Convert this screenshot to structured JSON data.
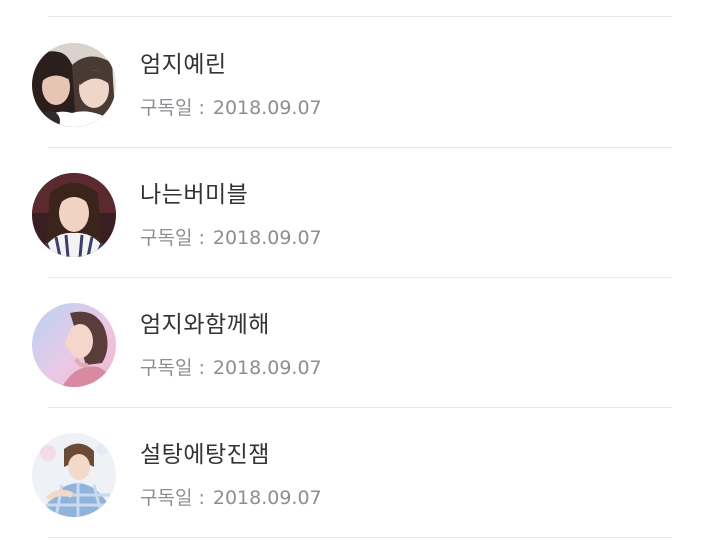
{
  "subscriptions": [
    {
      "name": "엄지예린",
      "date_label": "구독일",
      "separator": ":",
      "date": "2018.09.07"
    },
    {
      "name": "나는버미블",
      "date_label": "구독일",
      "separator": ":",
      "date": "2018.09.07"
    },
    {
      "name": "엄지와함께해",
      "date_label": "구독일",
      "separator": ":",
      "date": "2018.09.07"
    },
    {
      "name": "설탕에탕진잼",
      "date_label": "구독일",
      "separator": ":",
      "date": "2018.09.07"
    }
  ],
  "colors": {
    "name_text": "#333333",
    "meta_text": "#8a8f94",
    "divider": "#e8e8e8",
    "background": "#ffffff"
  }
}
